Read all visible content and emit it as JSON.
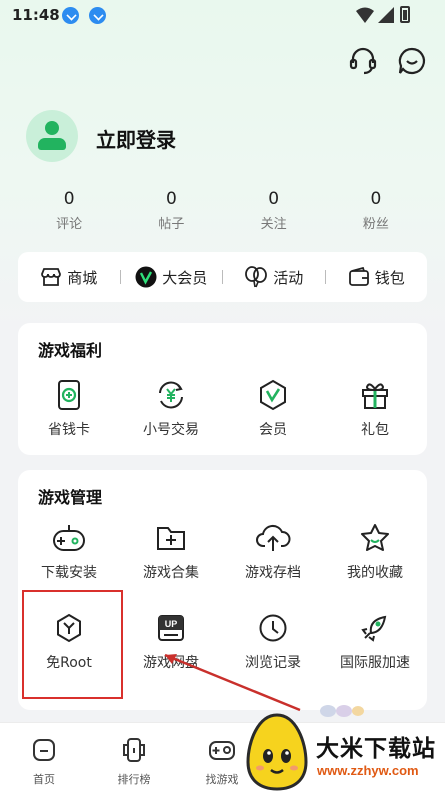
{
  "status_bar": {
    "time": "11:48"
  },
  "profile": {
    "login_text": "立即登录"
  },
  "stats": [
    {
      "value": "0",
      "label": "评论"
    },
    {
      "value": "0",
      "label": "帖子"
    },
    {
      "value": "0",
      "label": "关注"
    },
    {
      "value": "0",
      "label": "粉丝"
    }
  ],
  "quick_bar": [
    {
      "label": "商城",
      "icon": "store-icon"
    },
    {
      "label": "大会员",
      "icon": "vip-icon"
    },
    {
      "label": "活动",
      "icon": "balloon-icon"
    },
    {
      "label": "钱包",
      "icon": "wallet-icon"
    }
  ],
  "benefits": {
    "title": "游戏福利",
    "items": [
      {
        "label": "省钱卡",
        "icon": "money-card-icon"
      },
      {
        "label": "小号交易",
        "icon": "yuan-exchange-icon"
      },
      {
        "label": "会员",
        "icon": "member-badge-icon"
      },
      {
        "label": "礼包",
        "icon": "gift-icon"
      }
    ]
  },
  "management": {
    "title": "游戏管理",
    "items": [
      {
        "label": "下载安装",
        "icon": "gamepad-icon"
      },
      {
        "label": "游戏合集",
        "icon": "folder-plus-icon"
      },
      {
        "label": "游戏存档",
        "icon": "cloud-upload-icon"
      },
      {
        "label": "我的收藏",
        "icon": "star-icon"
      },
      {
        "label": "免Root",
        "icon": "hexagon-y-icon"
      },
      {
        "label": "游戏网盘",
        "icon": "up-disk-icon"
      },
      {
        "label": "浏览记录",
        "icon": "clock-icon"
      },
      {
        "label": "国际服加速",
        "icon": "rocket-icon"
      }
    ]
  },
  "bottom_nav": [
    {
      "label": "首页",
      "icon": "home-icon"
    },
    {
      "label": "排行榜",
      "icon": "ranking-icon"
    },
    {
      "label": "找游戏",
      "icon": "find-game-icon"
    }
  ],
  "watermark": {
    "title": "大米下载站",
    "url": "www.zzhyw.com"
  },
  "colors": {
    "accent": "#22b35f",
    "highlight_box": "#d9302c",
    "watermark_url": "#e05a14"
  }
}
